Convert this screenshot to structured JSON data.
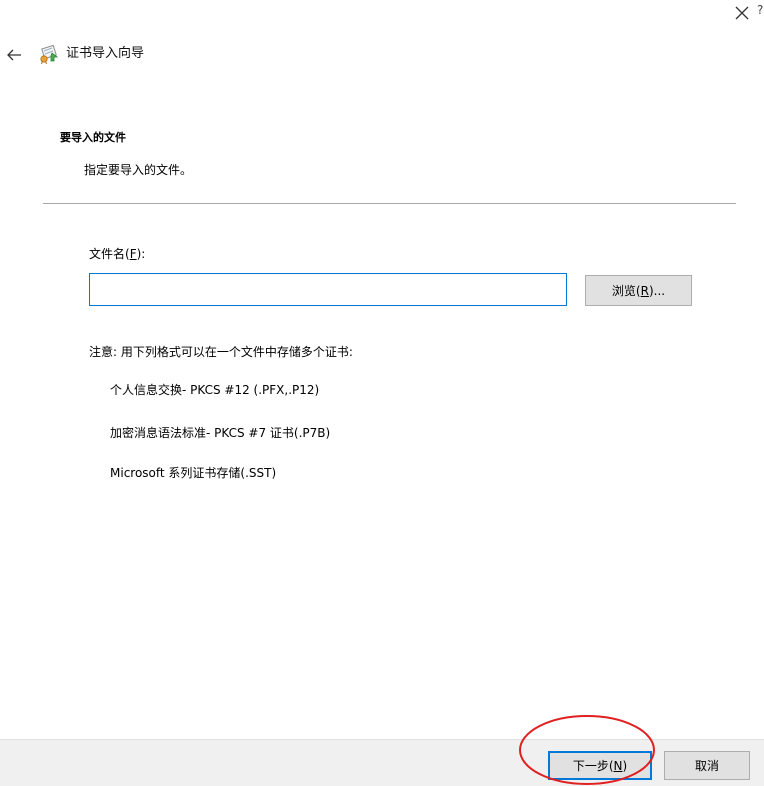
{
  "window": {
    "title": "证书导入向导",
    "close_icon": "close-icon",
    "back_icon": "back-arrow-icon",
    "wizard_icon": "certificate-icon",
    "edge_fragment": "?"
  },
  "section": {
    "heading": "要导入的文件",
    "description": "指定要导入的文件。"
  },
  "file": {
    "label_prefix": "文件名(",
    "label_key": "F",
    "label_suffix": "):",
    "value": "",
    "placeholder": "",
    "browse_prefix": "浏览(",
    "browse_key": "R",
    "browse_suffix": ")..."
  },
  "note": {
    "text": "注意: 用下列格式可以在一个文件中存储多个证书:",
    "formats": [
      "个人信息交换- PKCS #12 (.PFX,.P12)",
      "加密消息语法标准- PKCS #7 证书(.P7B)",
      "Microsoft 系列证书存储(.SST)"
    ]
  },
  "footer": {
    "next_prefix": "下一步(",
    "next_key": "N",
    "next_suffix": ")",
    "cancel_label": "取消",
    "highlight_color": "#e02020"
  },
  "colors": {
    "accent": "#0078d7",
    "footer_bg": "#f0f0f0",
    "button_bg": "#e1e1e1"
  }
}
